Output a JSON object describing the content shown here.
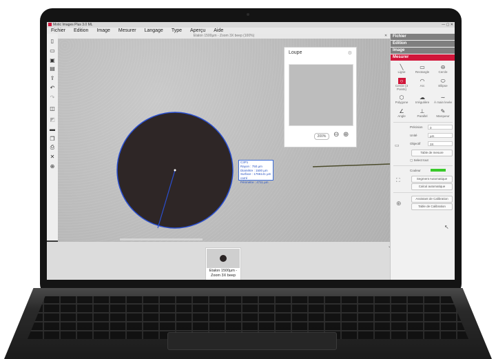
{
  "app": {
    "title": "Motic Images Plus 3.0 ML"
  },
  "menu": [
    "Fichier",
    "Edition",
    "Image",
    "Mesurer",
    "Langage",
    "Type",
    "Aperçu",
    "Aide"
  ],
  "document": {
    "title": "Etalon 1500µm - Zoom 3X beep (100%)"
  },
  "toolbar": {
    "icons": [
      "new-file-icon",
      "open-folder-icon",
      "save-icon",
      "save-as-icon",
      "export-icon",
      "undo-icon",
      "redo-icon",
      "crop-icon",
      "adjust-icon",
      "ruler-icon",
      "layers-icon",
      "print-icon",
      "tools-icon",
      "zoom-in-icon"
    ]
  },
  "loupe": {
    "title": "Loupe",
    "zoom": "200%"
  },
  "measurement": {
    "label": "C3P1",
    "rayon": "Rayon : 750 µm",
    "diametre": "Diamètre : 1500 µm",
    "surface": "Surface : 1766141 µm carré",
    "perimetre": "Périmètre : 4711 µm"
  },
  "thumbnail": {
    "label": "Etalon 1500µm - Zoom 3X beep"
  },
  "panel": {
    "sections": [
      "Fichier",
      "Edition",
      "Image",
      "Mesurer"
    ],
    "tools": [
      {
        "label": "Ligne",
        "icon": "line-icon"
      },
      {
        "label": "Rectangle",
        "icon": "rectangle-icon"
      },
      {
        "label": "Cercle",
        "icon": "circle-icon"
      },
      {
        "label": "Cercle (3 Points)",
        "icon": "circle-3-points-icon"
      },
      {
        "label": "Arc",
        "icon": "arc-icon"
      },
      {
        "label": "Ellipse",
        "icon": "ellipse-icon"
      },
      {
        "label": "Polygone",
        "icon": "polygon-icon"
      },
      {
        "label": "Irrégulière",
        "icon": "irregular-icon"
      },
      {
        "label": "À main levée",
        "icon": "freehand-icon"
      },
      {
        "label": "Angle",
        "icon": "angle-icon"
      },
      {
        "label": "Parallel",
        "icon": "parallel-icon"
      },
      {
        "label": "Marqueur",
        "icon": "marker-icon"
      }
    ],
    "precision_label": "Précision",
    "precision_value": "0",
    "unit_label": "Unité",
    "unit_value": "µm",
    "objective_label": "Objectif",
    "objective_value": "3X",
    "table_button": "Table de mesure",
    "select_all": "Select tout",
    "color_label": "Couleur",
    "color_value": "#39c92a",
    "auto_segment_button": "Segment Automatique",
    "auto_calc_button": "Calcul automatique",
    "calibration_assistant_button": "Assistant de Calibration",
    "calibration_table_button": "Table de Calibration"
  },
  "colors": {
    "accent": "#d1163a",
    "measure": "#3a6bd8",
    "sample": "#2e2626"
  }
}
